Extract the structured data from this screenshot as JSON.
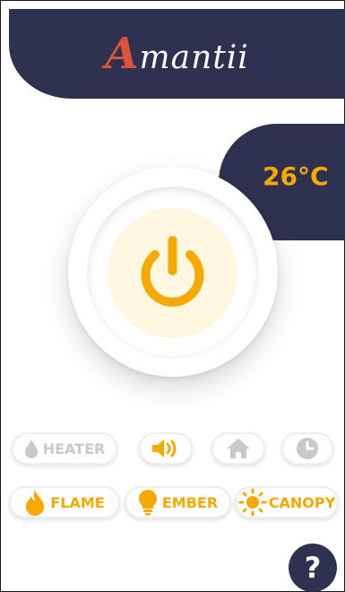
{
  "brand": {
    "initial": "A",
    "rest": "mantii"
  },
  "temperature": {
    "value": "26°C"
  },
  "power": {
    "state": "on"
  },
  "controls": {
    "heater": {
      "label": "HEATER",
      "active": false
    },
    "sound": {
      "active": true
    },
    "home": {
      "active": false
    },
    "timer": {
      "active": false
    },
    "flame": {
      "label": "FLAME",
      "active": true
    },
    "ember": {
      "label": "EMBER",
      "active": true
    },
    "canopy": {
      "label": "CANOPY",
      "active": true
    }
  },
  "help": {
    "label": "?"
  },
  "colors": {
    "navy": "#2f3150",
    "accent": "#f6a900",
    "brand_red": "#e0533b",
    "inactive": "#c9c9c9"
  },
  "icons": [
    "power-icon",
    "drop-icon",
    "speaker-icon",
    "home-icon",
    "clock-icon",
    "flame-icon",
    "bulb-icon",
    "sun-icon"
  ]
}
